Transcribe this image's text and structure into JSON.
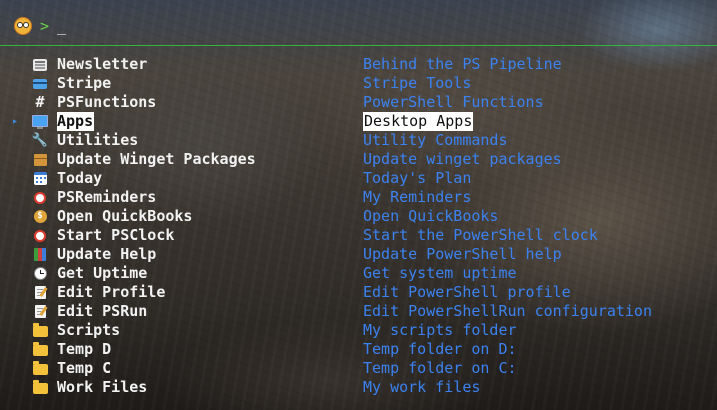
{
  "prompt": {
    "char": ">",
    "input": "_"
  },
  "menu": {
    "selected_marker": "▸",
    "items": [
      {
        "label": "Newsletter",
        "desc": "Behind the PS Pipeline",
        "icon": "newspaper-icon"
      },
      {
        "label": "Stripe",
        "desc": "Stripe Tools",
        "icon": "credit-card-icon"
      },
      {
        "label": "PSFunctions",
        "desc": "PowerShell Functions",
        "icon": "hash-icon",
        "glyph": "#"
      },
      {
        "label": "Apps",
        "desc": "Desktop Apps",
        "icon": "monitor-icon",
        "selected": true
      },
      {
        "label": "Utilities",
        "desc": "Utility Commands",
        "icon": "wrench-icon"
      },
      {
        "label": "Update Winget Packages",
        "desc": "Update winget packages",
        "icon": "package-icon"
      },
      {
        "label": "Today",
        "desc": "Today's Plan",
        "icon": "calendar-icon"
      },
      {
        "label": "PSReminders",
        "desc": "My Reminders",
        "icon": "alarm-clock-icon"
      },
      {
        "label": "Open QuickBooks",
        "desc": "Open QuickBooks",
        "icon": "money-bag-icon"
      },
      {
        "label": "Start PSClock",
        "desc": "Start the PowerShell clock",
        "icon": "alarm-clock-icon"
      },
      {
        "label": "Update Help",
        "desc": "Update PowerShell help",
        "icon": "books-icon"
      },
      {
        "label": "Get Uptime",
        "desc": "Get system uptime",
        "icon": "clock-icon"
      },
      {
        "label": "Edit Profile",
        "desc": "Edit PowerShell profile",
        "icon": "memo-icon"
      },
      {
        "label": "Edit PSRun",
        "desc": "Edit PowerShellRun configuration",
        "icon": "memo-icon"
      },
      {
        "label": "Scripts",
        "desc": "My scripts folder",
        "icon": "folder-icon"
      },
      {
        "label": "Temp D",
        "desc": "Temp folder on D:",
        "icon": "folder-icon"
      },
      {
        "label": "Temp C",
        "desc": "Temp folder on C:",
        "icon": "folder-icon"
      },
      {
        "label": "Work Files",
        "desc": "My work files",
        "icon": "folder-icon"
      }
    ]
  },
  "colors": {
    "divider": "#35b43b",
    "prompt_char": "#6ad14a",
    "label": "#f2f2f2",
    "description": "#3b82f0",
    "selection_bg": "#ffffff",
    "marker": "#3a8ee6"
  }
}
